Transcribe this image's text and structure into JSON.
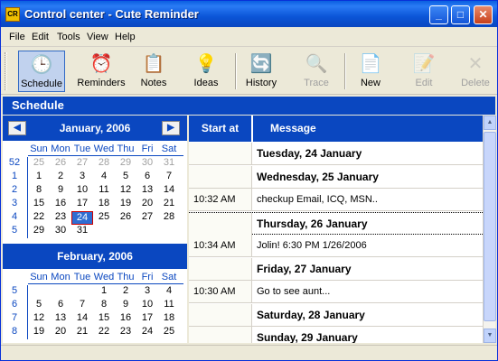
{
  "window": {
    "app_icon": "CR",
    "title": "Control center - Cute Reminder",
    "controls": [
      "_",
      "□",
      "✕"
    ]
  },
  "menu": [
    "File",
    "Edit",
    "Tools",
    "View",
    "Help"
  ],
  "toolbar": [
    {
      "label": "Schedule",
      "icon": "clock-icon",
      "glyph": "🕒",
      "selected": true,
      "disabled": false
    },
    {
      "label": "Reminders",
      "icon": "alarm-icon",
      "glyph": "⏰",
      "selected": false,
      "disabled": false
    },
    {
      "label": "Notes",
      "icon": "notes-icon",
      "glyph": "📋",
      "selected": false,
      "disabled": false
    },
    {
      "label": "Ideas",
      "icon": "ideas-icon",
      "glyph": "💡",
      "selected": false,
      "disabled": false
    },
    {
      "label": "History",
      "icon": "history-icon",
      "glyph": "🔄",
      "selected": false,
      "disabled": false
    },
    {
      "label": "Trace",
      "icon": "trace-icon",
      "glyph": "🔍",
      "selected": false,
      "disabled": true
    },
    {
      "label": "New",
      "icon": "new-document-icon",
      "glyph": "📄",
      "selected": false,
      "disabled": false
    },
    {
      "label": "Edit",
      "icon": "edit-document-icon",
      "glyph": "📝",
      "selected": false,
      "disabled": true
    },
    {
      "label": "Delete",
      "icon": "delete-icon",
      "glyph": "✕",
      "selected": false,
      "disabled": true
    }
  ],
  "section_title": "Schedule",
  "calendar": {
    "prev": "◀",
    "next": "▶",
    "weekdays": [
      "Sun",
      "Mon",
      "Tue",
      "Wed",
      "Thu",
      "Fri",
      "Sat"
    ],
    "months": [
      {
        "title": "January, 2006",
        "weeks": [
          {
            "num": "52",
            "days": [
              "25",
              "26",
              "27",
              "28",
              "29",
              "30",
              "31"
            ],
            "dim": [
              true,
              true,
              true,
              true,
              true,
              true,
              true
            ]
          },
          {
            "num": "1",
            "days": [
              "1",
              "2",
              "3",
              "4",
              "5",
              "6",
              "7"
            ]
          },
          {
            "num": "2",
            "days": [
              "8",
              "9",
              "10",
              "11",
              "12",
              "13",
              "14"
            ]
          },
          {
            "num": "3",
            "days": [
              "15",
              "16",
              "17",
              "18",
              "19",
              "20",
              "21"
            ]
          },
          {
            "num": "4",
            "days": [
              "22",
              "23",
              "24",
              "25",
              "26",
              "27",
              "28"
            ],
            "today": 2
          },
          {
            "num": "5",
            "days": [
              "29",
              "30",
              "31",
              "",
              "",
              "",
              ""
            ]
          }
        ]
      },
      {
        "title": "February, 2006",
        "weeks": [
          {
            "num": "5",
            "days": [
              "",
              "",
              "",
              "1",
              "2",
              "3",
              "4"
            ]
          },
          {
            "num": "6",
            "days": [
              "5",
              "6",
              "7",
              "8",
              "9",
              "10",
              "11"
            ]
          },
          {
            "num": "7",
            "days": [
              "12",
              "13",
              "14",
              "15",
              "16",
              "17",
              "18"
            ]
          },
          {
            "num": "8",
            "days": [
              "19",
              "20",
              "21",
              "22",
              "23",
              "24",
              "25"
            ]
          }
        ]
      }
    ]
  },
  "grid": {
    "columns": [
      "Start at",
      "Message"
    ],
    "rows": [
      {
        "type": "date",
        "time": "",
        "message": "Tuesday, 24 January"
      },
      {
        "type": "date",
        "time": "",
        "message": "Wednesday, 25 January"
      },
      {
        "type": "event",
        "time": "10:32 AM",
        "message": "checkup Email, ICQ, MSN.."
      },
      {
        "type": "date",
        "time": "",
        "message": "Thursday, 26 January",
        "focus": true
      },
      {
        "type": "event",
        "time": "10:34 AM",
        "message": "Jolin! 6:30 PM 1/26/2006"
      },
      {
        "type": "date",
        "time": "",
        "message": "Friday, 27 January"
      },
      {
        "type": "event",
        "time": "10:30 AM",
        "message": "Go to see aunt..."
      },
      {
        "type": "date",
        "time": "",
        "message": "Saturday, 28 January"
      },
      {
        "type": "date",
        "time": "",
        "message": "Sunday, 29 January"
      }
    ]
  },
  "scrollbar": {
    "up": "▲",
    "down": "▼"
  }
}
